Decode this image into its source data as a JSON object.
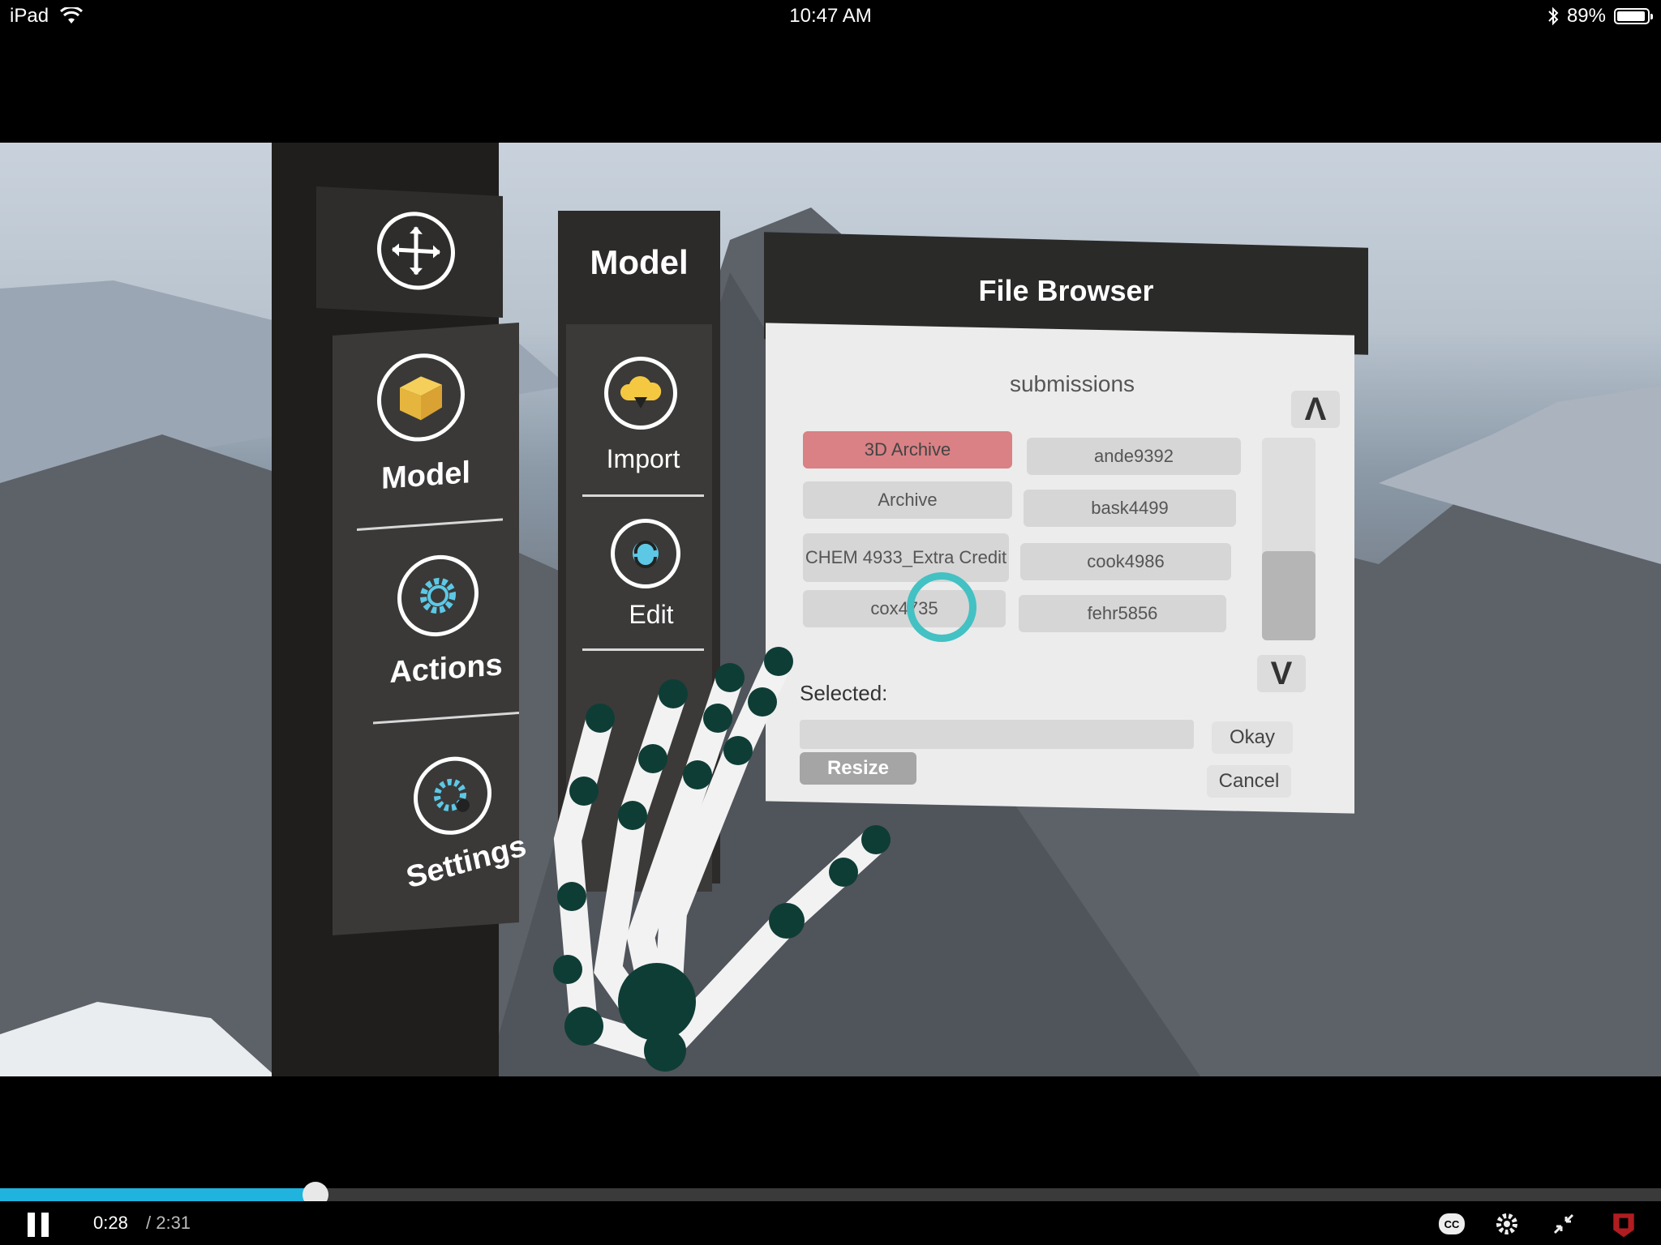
{
  "status_bar": {
    "device": "iPad",
    "time": "10:47 AM",
    "battery": "89%"
  },
  "main_menu": {
    "move_icon": "move-arrows-icon",
    "items": [
      {
        "label": "Model",
        "icon": "cube-icon"
      },
      {
        "label": "Actions",
        "icon": "gear-icon"
      },
      {
        "label": "Settings",
        "icon": "settings-gear-icon"
      }
    ]
  },
  "model_menu": {
    "title": "Model",
    "items": [
      {
        "label": "Import",
        "icon": "cloud-download-icon"
      },
      {
        "label": "Edit",
        "icon": "edit-rotate-icon"
      }
    ]
  },
  "file_browser": {
    "title": "File Browser",
    "folder": "submissions",
    "files": [
      {
        "label": "3D Archive",
        "selected": true
      },
      {
        "label": "ande9392",
        "selected": false
      },
      {
        "label": "Archive",
        "selected": false
      },
      {
        "label": "bask4499",
        "selected": false
      },
      {
        "label": "CHEM 4933_Extra Credit",
        "selected": false
      },
      {
        "label": "cook4986",
        "selected": false
      },
      {
        "label": "cox4735",
        "selected": false
      },
      {
        "label": "fehr5856",
        "selected": false
      }
    ],
    "scroll_up": "Λ",
    "scroll_down": "V",
    "selected_label": "Selected:",
    "selected_value": "",
    "okay": "Okay",
    "cancel": "Cancel",
    "resize": "Resize"
  },
  "player": {
    "current_time": "0:28",
    "total_time": "/ 2:31",
    "progress_fraction": 0.19,
    "accent_color": "#1fb3dd"
  }
}
